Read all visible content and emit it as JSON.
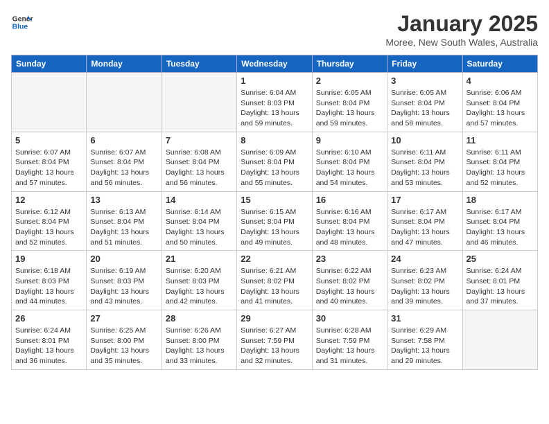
{
  "header": {
    "logo_line1": "General",
    "logo_line2": "Blue",
    "title": "January 2025",
    "subtitle": "Moree, New South Wales, Australia"
  },
  "weekdays": [
    "Sunday",
    "Monday",
    "Tuesday",
    "Wednesday",
    "Thursday",
    "Friday",
    "Saturday"
  ],
  "weeks": [
    [
      {
        "day": "",
        "info": ""
      },
      {
        "day": "",
        "info": ""
      },
      {
        "day": "",
        "info": ""
      },
      {
        "day": "1",
        "info": "Sunrise: 6:04 AM\nSunset: 8:03 PM\nDaylight: 13 hours\nand 59 minutes."
      },
      {
        "day": "2",
        "info": "Sunrise: 6:05 AM\nSunset: 8:04 PM\nDaylight: 13 hours\nand 59 minutes."
      },
      {
        "day": "3",
        "info": "Sunrise: 6:05 AM\nSunset: 8:04 PM\nDaylight: 13 hours\nand 58 minutes."
      },
      {
        "day": "4",
        "info": "Sunrise: 6:06 AM\nSunset: 8:04 PM\nDaylight: 13 hours\nand 57 minutes."
      }
    ],
    [
      {
        "day": "5",
        "info": "Sunrise: 6:07 AM\nSunset: 8:04 PM\nDaylight: 13 hours\nand 57 minutes."
      },
      {
        "day": "6",
        "info": "Sunrise: 6:07 AM\nSunset: 8:04 PM\nDaylight: 13 hours\nand 56 minutes."
      },
      {
        "day": "7",
        "info": "Sunrise: 6:08 AM\nSunset: 8:04 PM\nDaylight: 13 hours\nand 56 minutes."
      },
      {
        "day": "8",
        "info": "Sunrise: 6:09 AM\nSunset: 8:04 PM\nDaylight: 13 hours\nand 55 minutes."
      },
      {
        "day": "9",
        "info": "Sunrise: 6:10 AM\nSunset: 8:04 PM\nDaylight: 13 hours\nand 54 minutes."
      },
      {
        "day": "10",
        "info": "Sunrise: 6:11 AM\nSunset: 8:04 PM\nDaylight: 13 hours\nand 53 minutes."
      },
      {
        "day": "11",
        "info": "Sunrise: 6:11 AM\nSunset: 8:04 PM\nDaylight: 13 hours\nand 52 minutes."
      }
    ],
    [
      {
        "day": "12",
        "info": "Sunrise: 6:12 AM\nSunset: 8:04 PM\nDaylight: 13 hours\nand 52 minutes."
      },
      {
        "day": "13",
        "info": "Sunrise: 6:13 AM\nSunset: 8:04 PM\nDaylight: 13 hours\nand 51 minutes."
      },
      {
        "day": "14",
        "info": "Sunrise: 6:14 AM\nSunset: 8:04 PM\nDaylight: 13 hours\nand 50 minutes."
      },
      {
        "day": "15",
        "info": "Sunrise: 6:15 AM\nSunset: 8:04 PM\nDaylight: 13 hours\nand 49 minutes."
      },
      {
        "day": "16",
        "info": "Sunrise: 6:16 AM\nSunset: 8:04 PM\nDaylight: 13 hours\nand 48 minutes."
      },
      {
        "day": "17",
        "info": "Sunrise: 6:17 AM\nSunset: 8:04 PM\nDaylight: 13 hours\nand 47 minutes."
      },
      {
        "day": "18",
        "info": "Sunrise: 6:17 AM\nSunset: 8:04 PM\nDaylight: 13 hours\nand 46 minutes."
      }
    ],
    [
      {
        "day": "19",
        "info": "Sunrise: 6:18 AM\nSunset: 8:03 PM\nDaylight: 13 hours\nand 44 minutes."
      },
      {
        "day": "20",
        "info": "Sunrise: 6:19 AM\nSunset: 8:03 PM\nDaylight: 13 hours\nand 43 minutes."
      },
      {
        "day": "21",
        "info": "Sunrise: 6:20 AM\nSunset: 8:03 PM\nDaylight: 13 hours\nand 42 minutes."
      },
      {
        "day": "22",
        "info": "Sunrise: 6:21 AM\nSunset: 8:02 PM\nDaylight: 13 hours\nand 41 minutes."
      },
      {
        "day": "23",
        "info": "Sunrise: 6:22 AM\nSunset: 8:02 PM\nDaylight: 13 hours\nand 40 minutes."
      },
      {
        "day": "24",
        "info": "Sunrise: 6:23 AM\nSunset: 8:02 PM\nDaylight: 13 hours\nand 39 minutes."
      },
      {
        "day": "25",
        "info": "Sunrise: 6:24 AM\nSunset: 8:01 PM\nDaylight: 13 hours\nand 37 minutes."
      }
    ],
    [
      {
        "day": "26",
        "info": "Sunrise: 6:24 AM\nSunset: 8:01 PM\nDaylight: 13 hours\nand 36 minutes."
      },
      {
        "day": "27",
        "info": "Sunrise: 6:25 AM\nSunset: 8:00 PM\nDaylight: 13 hours\nand 35 minutes."
      },
      {
        "day": "28",
        "info": "Sunrise: 6:26 AM\nSunset: 8:00 PM\nDaylight: 13 hours\nand 33 minutes."
      },
      {
        "day": "29",
        "info": "Sunrise: 6:27 AM\nSunset: 7:59 PM\nDaylight: 13 hours\nand 32 minutes."
      },
      {
        "day": "30",
        "info": "Sunrise: 6:28 AM\nSunset: 7:59 PM\nDaylight: 13 hours\nand 31 minutes."
      },
      {
        "day": "31",
        "info": "Sunrise: 6:29 AM\nSunset: 7:58 PM\nDaylight: 13 hours\nand 29 minutes."
      },
      {
        "day": "",
        "info": ""
      }
    ]
  ]
}
